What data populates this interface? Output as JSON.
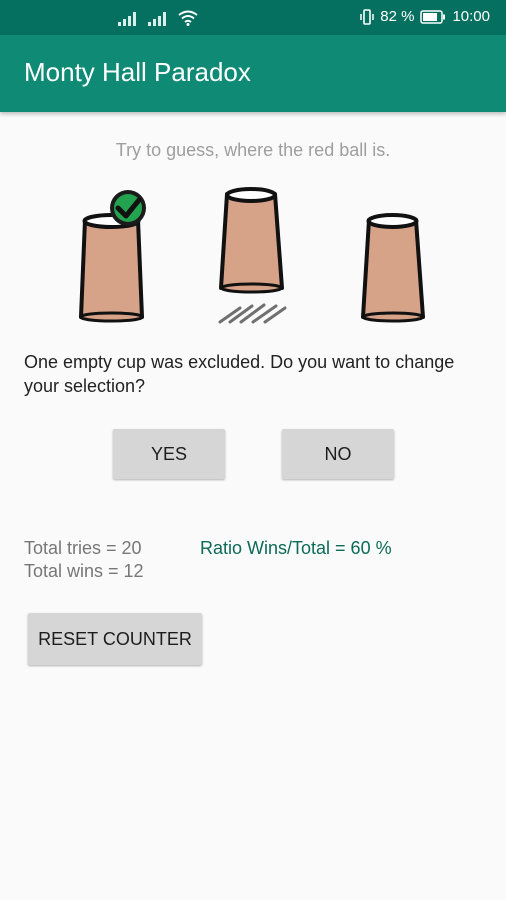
{
  "status_bar": {
    "battery_percent": "82 %",
    "time": "10:00",
    "icons": [
      "signal-icon",
      "signal-icon",
      "wifi-icon",
      "vibrate-icon",
      "battery-icon"
    ]
  },
  "app": {
    "title": "Monty Hall Paradox",
    "colors": {
      "primary": "#0f8a75",
      "primary_dark": "#05705f",
      "accent_text": "#0b6b57"
    }
  },
  "game": {
    "hint": "Try to guess, where the red ball is.",
    "question": "One empty cup was excluded. Do you want to change your selection?",
    "cups": [
      {
        "id": 1,
        "state": "selected"
      },
      {
        "id": 2,
        "state": "lifted-empty"
      },
      {
        "id": 3,
        "state": "normal"
      }
    ],
    "yes_label": "YES",
    "no_label": "NO"
  },
  "stats": {
    "total_tries": "Total tries = 20",
    "total_wins": "Total wins = 12",
    "ratio": "Ratio Wins/Total = 60 %",
    "reset_label": "RESET COUNTER"
  }
}
